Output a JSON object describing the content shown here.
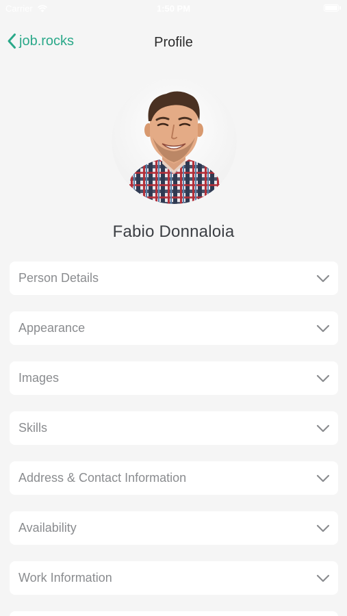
{
  "status_bar": {
    "carrier": "Carrier",
    "time": "1:50 PM"
  },
  "nav": {
    "back_label": "job.rocks",
    "title": "Profile"
  },
  "profile": {
    "name": "Fabio Donnaloia"
  },
  "sections": [
    {
      "label": "Person Details",
      "icon": "chevron-down-icon"
    },
    {
      "label": "Appearance",
      "icon": "chevron-down-icon"
    },
    {
      "label": "Images",
      "icon": "chevron-down-icon"
    },
    {
      "label": "Skills",
      "icon": "chevron-down-icon"
    },
    {
      "label": "Address & Contact Information",
      "icon": "chevron-down-icon"
    },
    {
      "label": "Availability",
      "icon": "chevron-down-icon"
    },
    {
      "label": "Work Information",
      "icon": "chevron-down-icon"
    },
    {
      "label": "",
      "icon": "chevron-down-icon"
    }
  ],
  "colors": {
    "accent": "#2aa889",
    "background": "#f5f5f5",
    "card": "#ffffff",
    "label": "#8a8c8f",
    "title": "#2b2b2b"
  }
}
